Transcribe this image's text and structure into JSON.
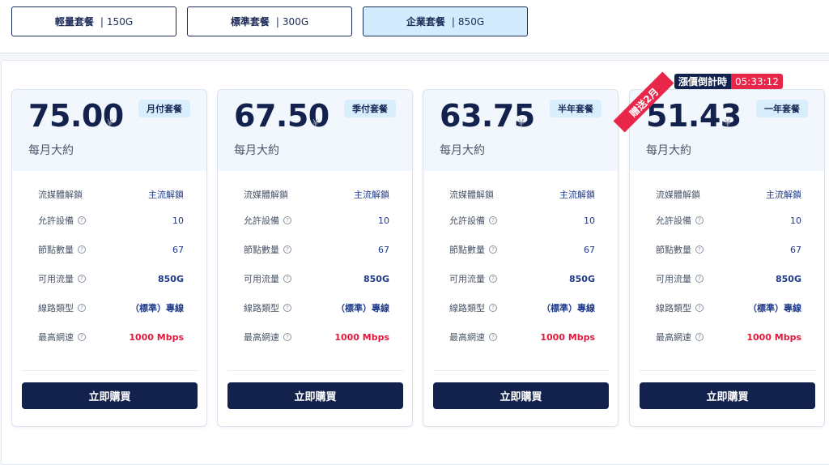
{
  "tabs": [
    {
      "name": "輕量套餐",
      "size": "150G"
    },
    {
      "name": "標準套餐",
      "size": "300G"
    },
    {
      "name": "企業套餐",
      "size": "850G"
    }
  ],
  "promo": {
    "countdown_label": "漲價倒計時",
    "countdown_time": "05:33:12",
    "ribbon": "贈送2月"
  },
  "cards": [
    {
      "price": "75.00",
      "currency": "¥",
      "period": "月付套餐",
      "monthly_label": "每月大約"
    },
    {
      "price": "67.50",
      "currency": "¥",
      "period": "季付套餐",
      "monthly_label": "每月大約"
    },
    {
      "price": "63.75",
      "currency": "¥",
      "period": "半年套餐",
      "monthly_label": "每月大約"
    },
    {
      "price": "51.43",
      "currency": "¥",
      "period": "一年套餐",
      "monthly_label": "每月大約"
    }
  ],
  "features": [
    {
      "label": "流媒體解鎖",
      "value": "主流解鎖",
      "help": false,
      "style": "normal"
    },
    {
      "label": "允許設備",
      "value": "10",
      "help": true,
      "style": "normal"
    },
    {
      "label": "節點數量",
      "value": "67",
      "help": true,
      "style": "normal"
    },
    {
      "label": "可用流量",
      "value": "850G",
      "help": true,
      "style": "bold"
    },
    {
      "label": "線路類型",
      "value": "（標準）專線",
      "help": true,
      "style": "bold"
    },
    {
      "label": "最高網速",
      "value": "1000 Mbps",
      "help": true,
      "style": "red"
    }
  ],
  "buy_label": "立即購買",
  "help_glyph": "?"
}
